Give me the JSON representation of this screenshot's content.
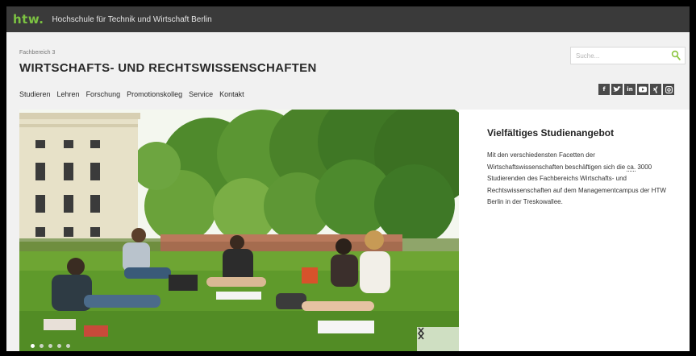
{
  "topbar": {
    "logo": "htw.",
    "title": "Hochschule für Technik und Wirtschaft Berlin"
  },
  "header": {
    "kicker": "Fachbereich 3",
    "title": "WIRTSCHAFTS- UND RECHTSWISSENSCHAFTEN"
  },
  "search": {
    "placeholder": "Suche..."
  },
  "nav": {
    "items": [
      "Studieren",
      "Lehren",
      "Forschung",
      "Promotionskolleg",
      "Service",
      "Kontakt"
    ]
  },
  "social": {
    "labels": [
      "f",
      "t",
      "in",
      "yt",
      "xi",
      "ig"
    ]
  },
  "slider": {
    "slide_count": 5,
    "active_index": 0
  },
  "panel": {
    "title": "Vielfältiges Studienangebot",
    "text_before": "Mit den verschiedensten Facetten der Wirtschaftswissenschaften beschäftigen sich die ",
    "abbr": "ca.",
    "text_after": " 3000 Studierenden des Fachbereichs Wirtschafts- und Rechtswissenschaften auf dem Managementcampus der HTW Berlin in der Treskowallee."
  },
  "colors": {
    "topbar": "#3a3a3a",
    "logo_green": "#7cc242",
    "page_background": "#f1f1f1"
  }
}
